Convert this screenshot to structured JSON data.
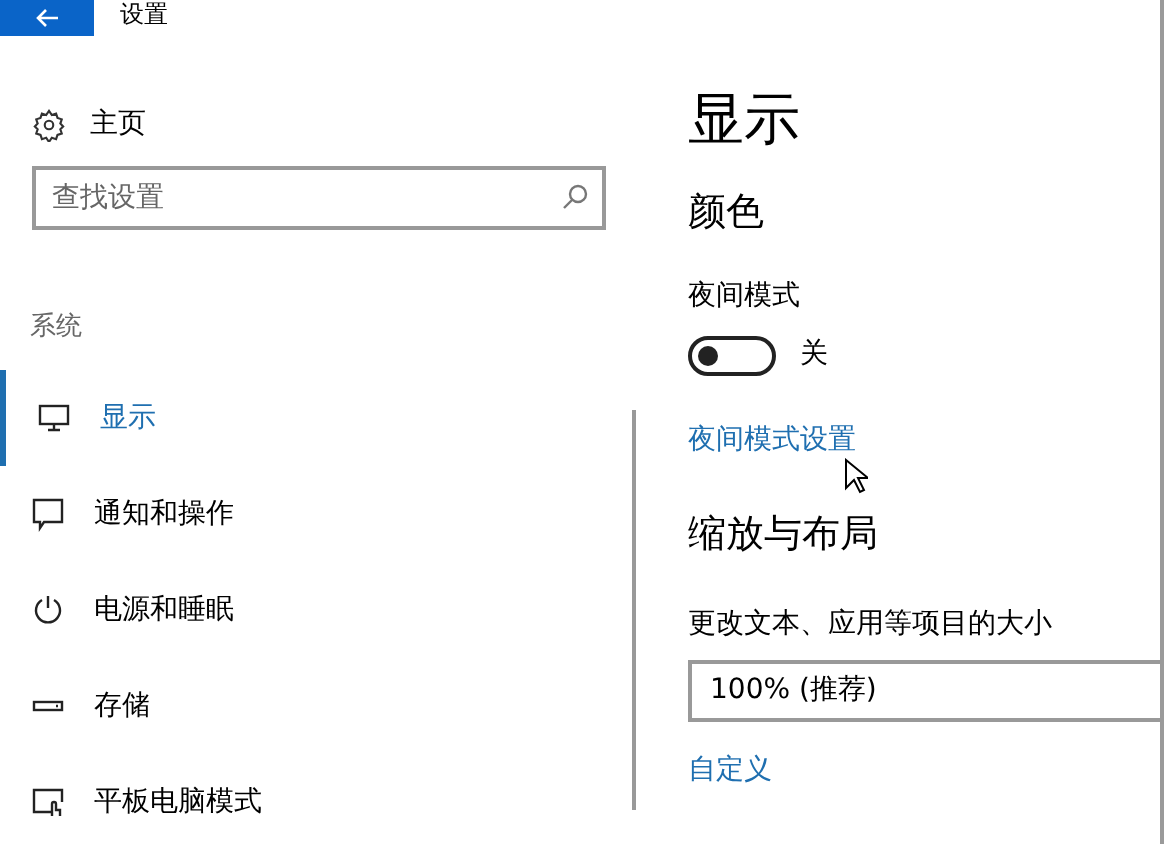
{
  "window": {
    "title": "设置"
  },
  "sidebar": {
    "home": "主页",
    "search": {
      "placeholder": "查找设置"
    },
    "section": "系统",
    "items": [
      {
        "label": "显示",
        "kind": "monitor",
        "selected": true
      },
      {
        "label": "通知和操作",
        "kind": "message",
        "selected": false
      },
      {
        "label": "电源和睡眠",
        "kind": "power",
        "selected": false
      },
      {
        "label": "存储",
        "kind": "drive",
        "selected": false
      },
      {
        "label": "平板电脑模式",
        "kind": "tablet",
        "selected": false
      }
    ]
  },
  "content": {
    "title": "显示",
    "color_heading": "颜色",
    "night_label": "夜间模式",
    "night_toggle": {
      "on": false,
      "state_text": "关"
    },
    "night_link": "夜间模式设置",
    "scale_heading": "缩放与布局",
    "scale_label": "更改文本、应用等项目的大小",
    "scale_value": "100% (推荐)",
    "custom_link": "自定义"
  }
}
